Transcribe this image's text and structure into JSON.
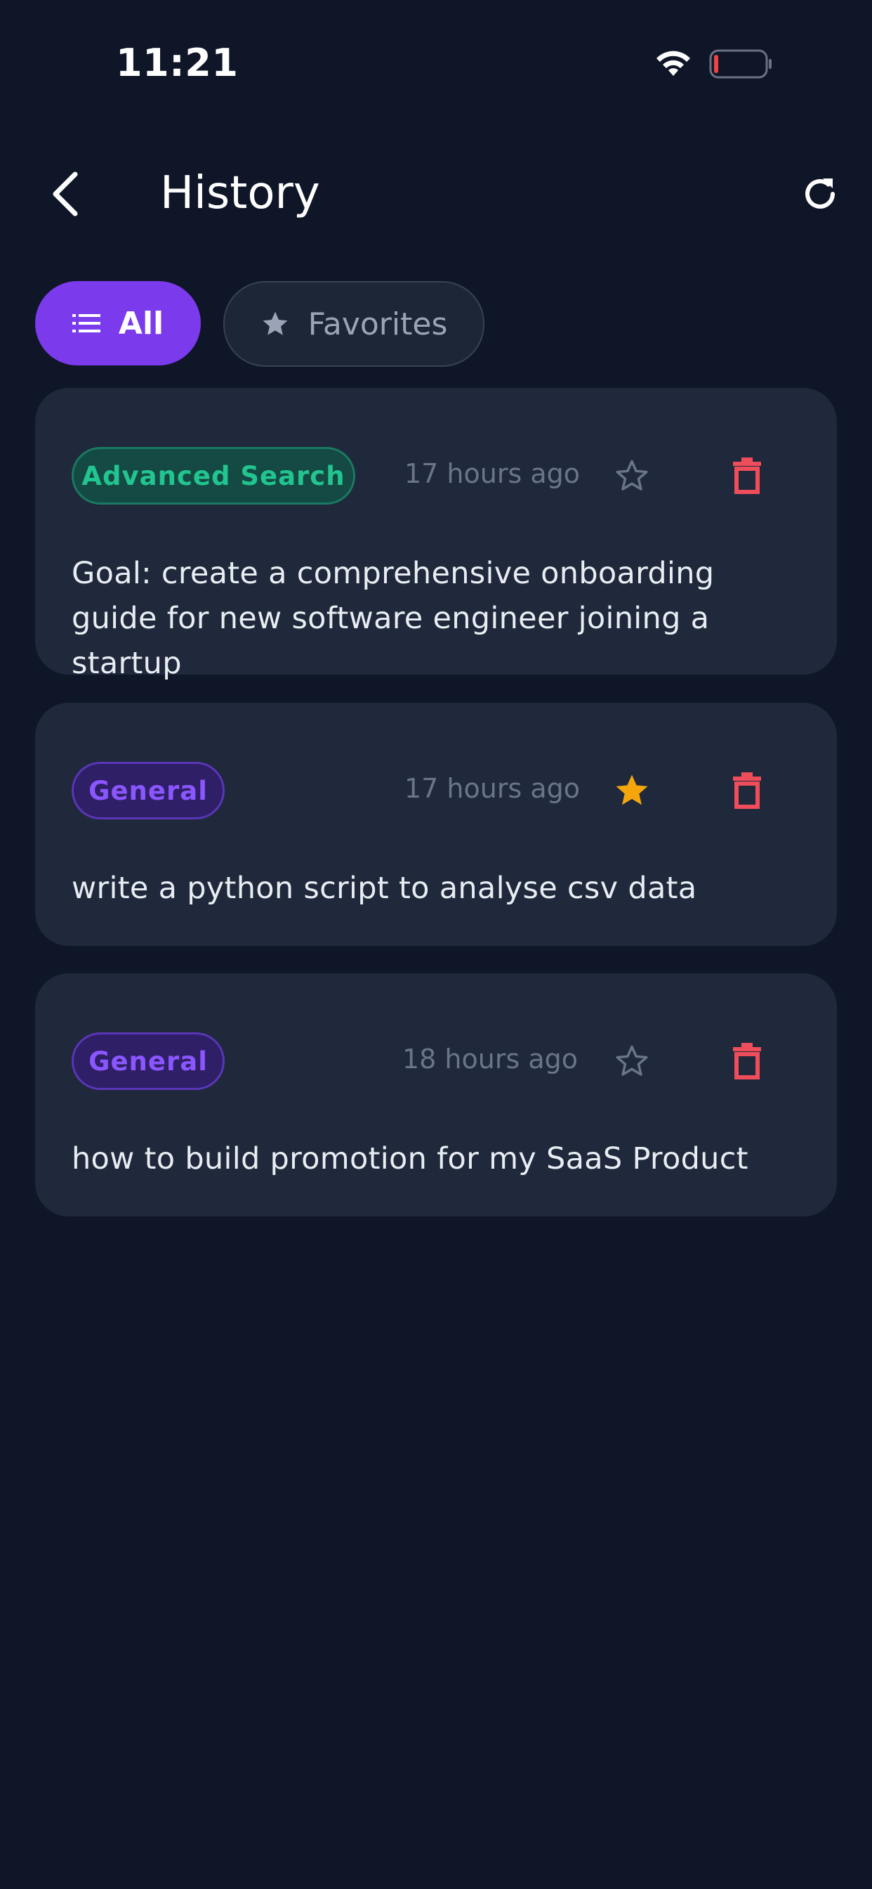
{
  "status_bar": {
    "time": "11:21",
    "wifi_icon": "wifi-icon",
    "battery_icon": "battery-low-icon"
  },
  "header": {
    "title": "History",
    "back_icon": "chevron-left-icon",
    "refresh_icon": "refresh-icon"
  },
  "filters": [
    {
      "label": "All",
      "icon": "list-icon",
      "active": true
    },
    {
      "label": "Favorites",
      "icon": "star-icon",
      "active": false
    }
  ],
  "items": [
    {
      "tag": "Advanced Search",
      "tag_color": "#22c58f",
      "time": "17 hours ago",
      "favorite": false,
      "text": "Goal: create a comprehensive onboarding guide for new software engineer joining a startup"
    },
    {
      "tag": "General",
      "tag_color": "#8b56ff",
      "time": "17 hours ago",
      "favorite": true,
      "text": "write a python script to analyse csv data"
    },
    {
      "tag": "General",
      "tag_color": "#8b56ff",
      "time": "18 hours ago",
      "favorite": false,
      "text": "how to build promotion for my SaaS Product"
    }
  ],
  "colors": {
    "accent": "#7c3aed",
    "background": "#0f1628",
    "card": "#1f293b",
    "favorite": "#f5a60d",
    "delete": "#ef4d5a"
  }
}
